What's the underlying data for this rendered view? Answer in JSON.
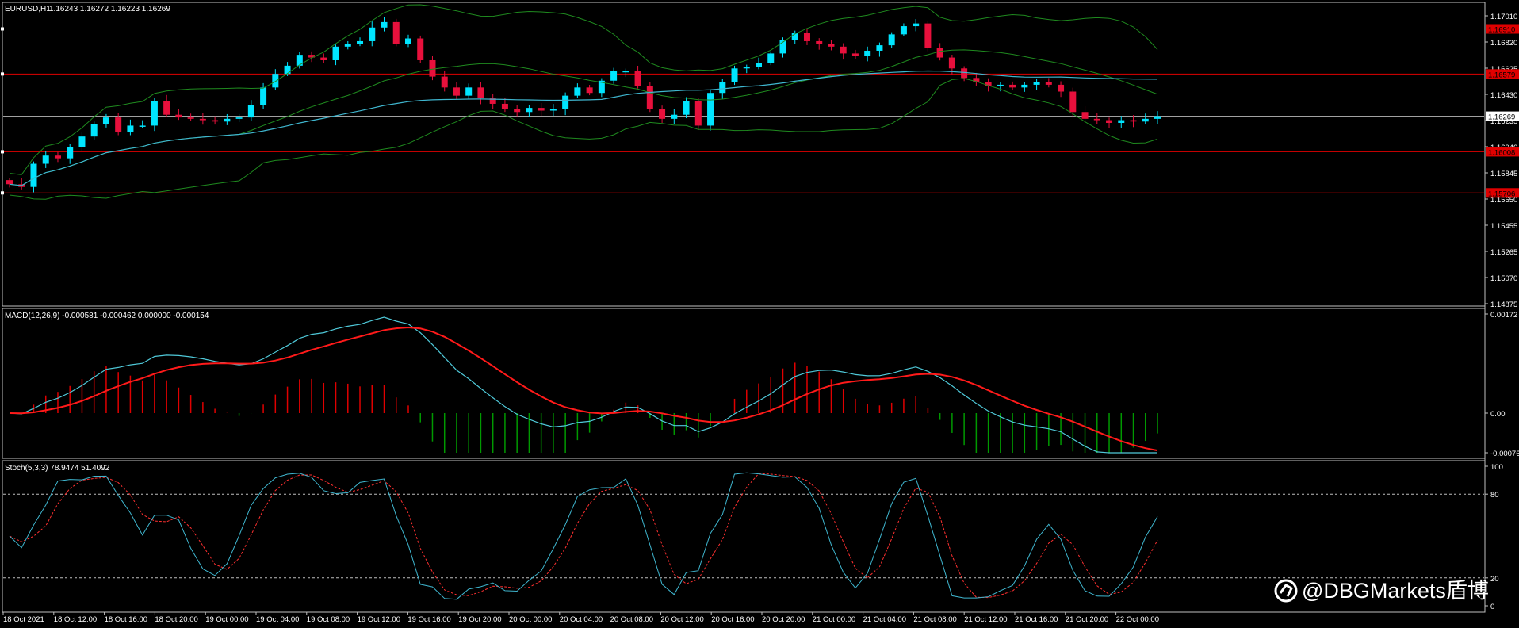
{
  "header": {
    "symbol": "EURUSD,H1",
    "quote": "1.16243 1.16272 1.16223 1.16269"
  },
  "colors": {
    "bull": "#00e5ff",
    "bear": "#e8103c",
    "bands": "#1f8a1f",
    "ma": "#3fb6cf",
    "hline": "#e00000",
    "macd_hist_pos": "#e00000",
    "macd_hist_neg": "#009900",
    "macd_line": "#4fc9d9",
    "signal_line": "#ff1a1a",
    "stoch_main": "#3fb6cf",
    "stoch_signal": "#ff3030",
    "grid_frame": "#c0c0c0"
  },
  "price_axis": {
    "ticks": [
      "1.17010",
      "1.16820",
      "1.16625",
      "1.16430",
      "1.16235",
      "1.16040",
      "1.15845",
      "1.15650",
      "1.15455",
      "1.15265",
      "1.15070",
      "1.14875"
    ],
    "current": "1.16269",
    "red_lines": [
      {
        "value": "1.16910",
        "price": 1.1691
      },
      {
        "value": "1.16579",
        "price": 1.16579
      },
      {
        "value": "1.16008",
        "price": 1.16008
      },
      {
        "value": "1.15706",
        "price": 1.15706
      }
    ]
  },
  "macd": {
    "label": "MACD(12,26,9) -0.000581 -0.000462 0.000000 -0.000154",
    "ticks": [
      "0.00172",
      "0.00",
      "-0.000767"
    ]
  },
  "stoch": {
    "label": "Stoch(5,3,3) 78.9474 51.4092",
    "ticks": [
      "100",
      "80",
      "20",
      "0"
    ]
  },
  "time_axis": [
    "18 Oct 2021",
    "18 Oct 12:00",
    "18 Oct 16:00",
    "18 Oct 20:00",
    "19 Oct 00:00",
    "19 Oct 04:00",
    "19 Oct 08:00",
    "19 Oct 12:00",
    "19 Oct 16:00",
    "19 Oct 20:00",
    "20 Oct 00:00",
    "20 Oct 04:00",
    "20 Oct 08:00",
    "20 Oct 12:00",
    "20 Oct 16:00",
    "20 Oct 20:00",
    "21 Oct 00:00",
    "21 Oct 04:00",
    "21 Oct 08:00",
    "21 Oct 12:00",
    "21 Oct 16:00",
    "21 Oct 20:00",
    "22 Oct 00:00"
  ],
  "watermark": "@DBGMarkets盾博",
  "chart_data": {
    "type": "candlestick",
    "symbol": "EURUSD",
    "timeframe": "H1",
    "y_range": [
      1.14875,
      1.17105
    ],
    "candles_close": [
      1.1577,
      1.1575,
      1.1592,
      1.1598,
      1.1596,
      1.1604,
      1.1612,
      1.1621,
      1.1626,
      1.1615,
      1.162,
      1.162,
      1.1638,
      1.1628,
      1.1626,
      1.1625,
      1.1624,
      1.1623,
      1.1625,
      1.1626,
      1.1635,
      1.1648,
      1.1658,
      1.1664,
      1.1672,
      1.167,
      1.1668,
      1.1678,
      1.168,
      1.1682,
      1.1692,
      1.1696,
      1.168,
      1.1684,
      1.1668,
      1.1656,
      1.1648,
      1.1642,
      1.1648,
      1.164,
      1.1636,
      1.1632,
      1.163,
      1.1633,
      1.1631,
      1.1632,
      1.1642,
      1.1648,
      1.1644,
      1.1653,
      1.166,
      1.166,
      1.1649,
      1.1632,
      1.1625,
      1.1628,
      1.1638,
      1.162,
      1.1644,
      1.1652,
      1.1662,
      1.1663,
      1.1666,
      1.1673,
      1.1683,
      1.1688,
      1.1682,
      1.168,
      1.1678,
      1.1673,
      1.1671,
      1.1675,
      1.1679,
      1.1687,
      1.1693,
      1.1695,
      1.1677,
      1.167,
      1.1662,
      1.1655,
      1.1652,
      1.1649,
      1.165,
      1.1648,
      1.165,
      1.1652,
      1.165,
      1.1645,
      1.163,
      1.1625,
      1.1624,
      1.1622,
      1.1624,
      1.1623,
      1.1625,
      1.16269
    ]
  }
}
